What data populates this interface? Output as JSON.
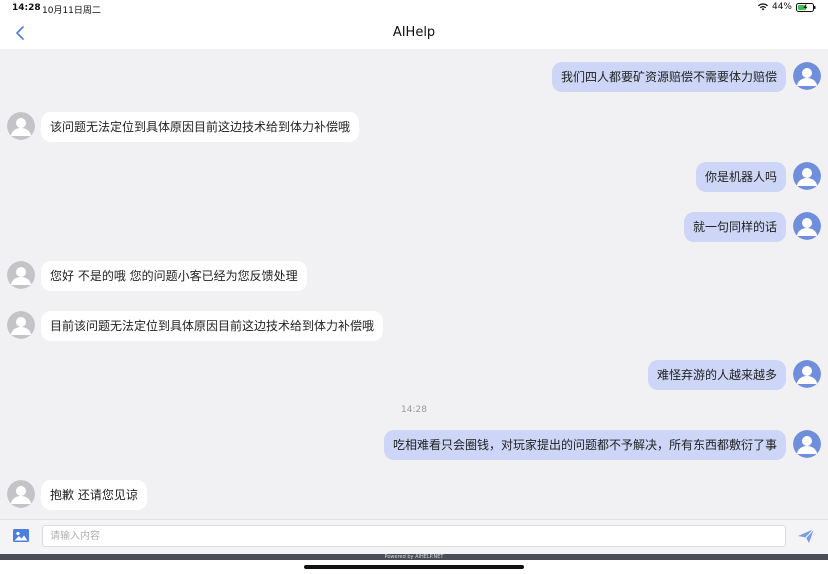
{
  "status_bar": {
    "time": "14:28",
    "date": "10月11日周二",
    "battery": "44%"
  },
  "header": {
    "title": "AIHelp"
  },
  "messages": [
    {
      "sender": "user",
      "text": "我们四人都要矿资源赔偿不需要体力赔偿"
    },
    {
      "sender": "agent",
      "text": "该问题无法定位到具体原因目前这边技术给到体力补偿哦"
    },
    {
      "sender": "user",
      "text": "你是机器人吗"
    },
    {
      "sender": "user",
      "text": "就一句同样的话"
    },
    {
      "sender": "agent",
      "text": "您好 不是的哦 您的问题小客已经为您反馈处理"
    },
    {
      "sender": "agent",
      "text": "目前该问题无法定位到具体原因目前这边技术给到体力补偿哦"
    },
    {
      "sender": "user",
      "text": "难怪弃游的人越来越多"
    },
    {
      "sender": "user",
      "text": "吃相难看只会圈钱，对玩家提出的问题都不予解决，所有东西都敷衍了事"
    },
    {
      "sender": "agent",
      "text": "抱歉 还请您见谅"
    }
  ],
  "timestamp": "14:28",
  "input": {
    "placeholder": "请输入内容",
    "value": ""
  },
  "footer": {
    "powered_by": "Powered by AIHELP.NET"
  },
  "colors": {
    "user_bubble": "#cdd6f6",
    "agent_bubble": "#ffffff",
    "accent": "#4a7fe0",
    "avatar_user": "#6f8fdc",
    "avatar_agent": "#c4c4c8"
  }
}
